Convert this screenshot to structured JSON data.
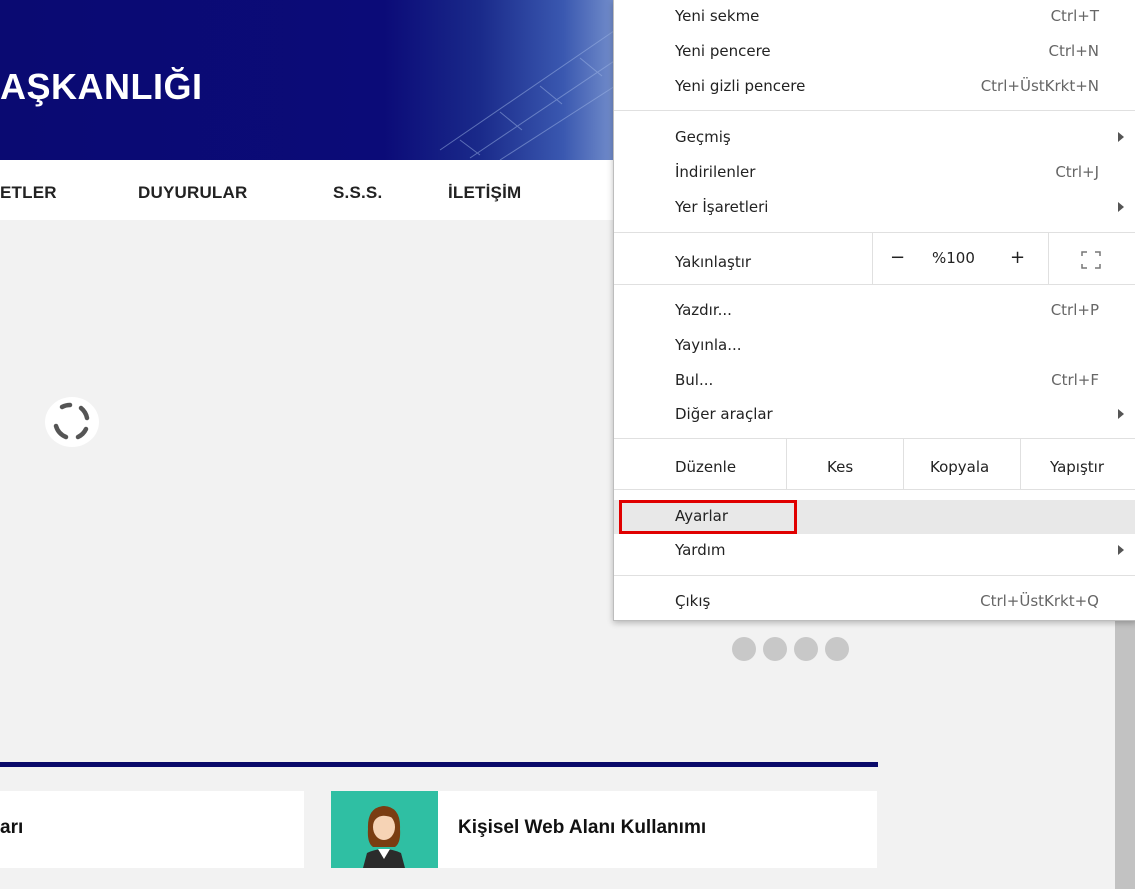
{
  "banner": {
    "title": "AŞKANLIĞI"
  },
  "nav": {
    "items": [
      "ETLER",
      "DUYURULAR",
      "S.S.S.",
      "İLETİŞİM"
    ]
  },
  "cards": {
    "left_text": "arı",
    "right_text": "Kişisel Web Alanı Kullanımı"
  },
  "menu": {
    "new_tab": {
      "label": "Yeni sekme",
      "shortcut": "Ctrl+T"
    },
    "new_window": {
      "label": "Yeni pencere",
      "shortcut": "Ctrl+N"
    },
    "new_incognito": {
      "label": "Yeni gizli pencere",
      "shortcut": "Ctrl+ÜstKrkt+N"
    },
    "history": {
      "label": "Geçmiş"
    },
    "downloads": {
      "label": "İndirilenler",
      "shortcut": "Ctrl+J"
    },
    "bookmarks": {
      "label": "Yer İşaretleri"
    },
    "zoom": {
      "label": "Yakınlaştır",
      "minus": "−",
      "value": "%100",
      "plus": "+"
    },
    "print": {
      "label": "Yazdır...",
      "shortcut": "Ctrl+P"
    },
    "cast": {
      "label": "Yayınla..."
    },
    "find": {
      "label": "Bul...",
      "shortcut": "Ctrl+F"
    },
    "more_tools": {
      "label": "Diğer araçlar"
    },
    "edit": {
      "label": "Düzenle",
      "cut": "Kes",
      "copy": "Kopyala",
      "paste": "Yapıştır"
    },
    "settings": {
      "label": "Ayarlar"
    },
    "help": {
      "label": "Yardım"
    },
    "exit": {
      "label": "Çıkış",
      "shortcut": "Ctrl+ÜstKrkt+Q"
    }
  },
  "colors": {
    "banner": "#0a0a72",
    "accent_red": "#e00000",
    "card_teal": "#2fbfa3"
  }
}
